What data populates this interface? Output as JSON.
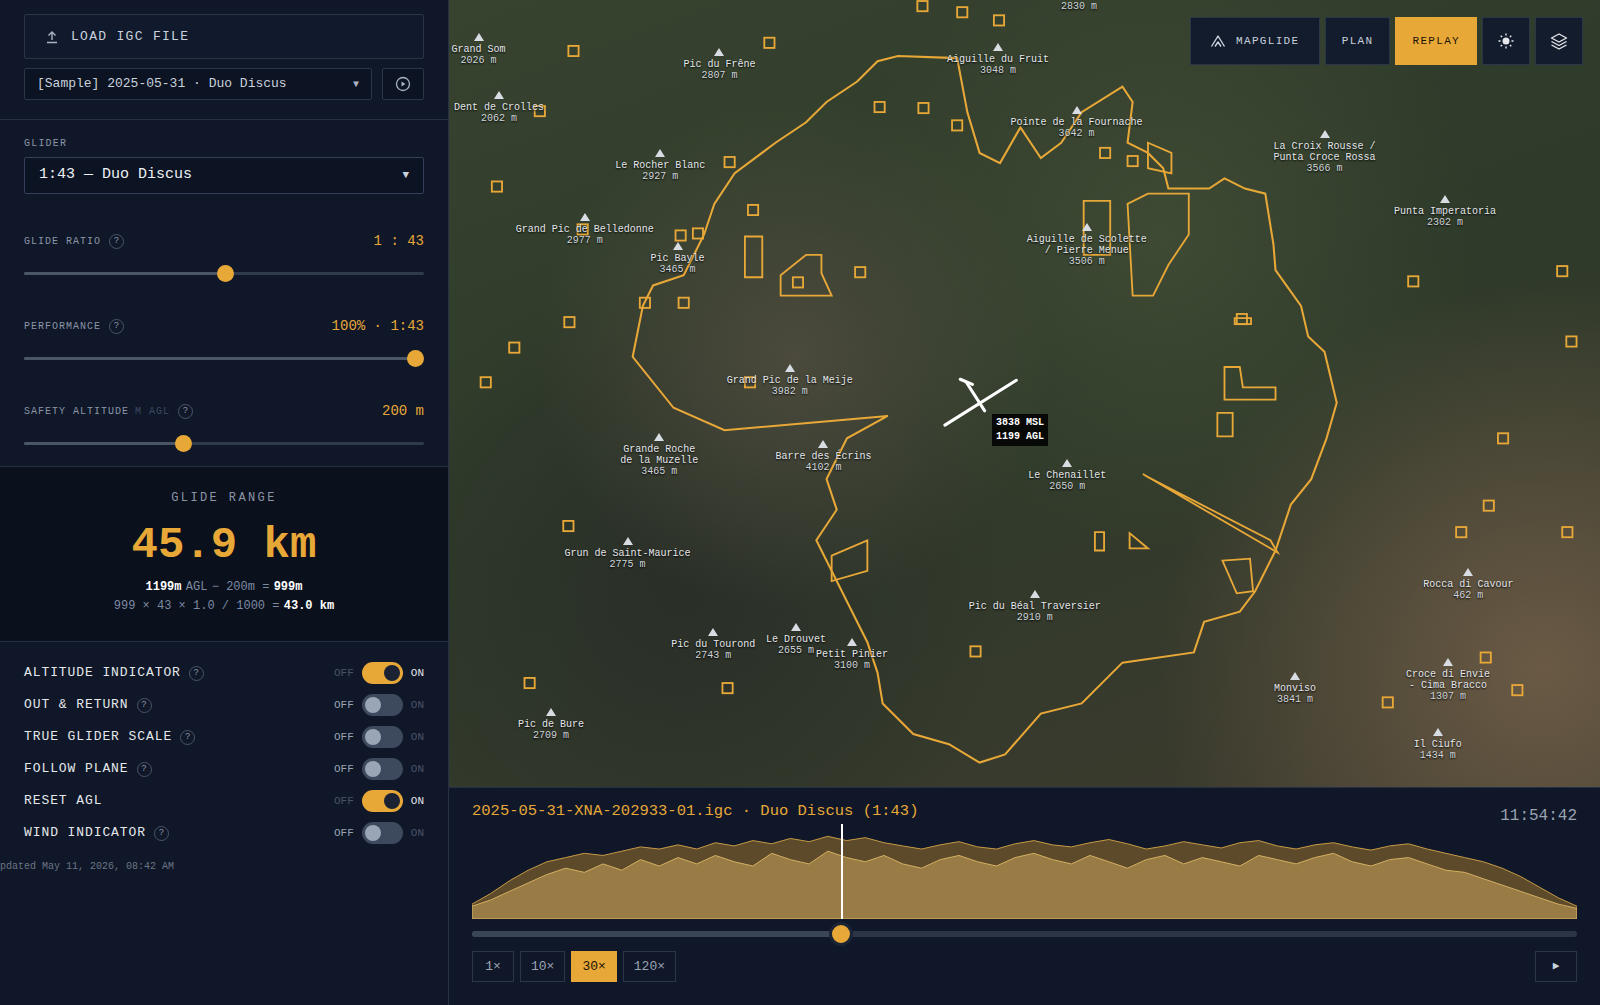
{
  "sidebar": {
    "load_button": {
      "label": "LOAD IGC FILE"
    },
    "file_select": {
      "value": "[Sample] 2025-05-31 · Duo Discus",
      "caret": "▼"
    },
    "glider": {
      "label": "GLIDER",
      "value": "1:43 — Duo Discus",
      "caret": "▼"
    },
    "sliders": [
      {
        "label": "GLIDE RATIO",
        "help": "?",
        "reading": "1 : 43",
        "level": 0.506
      },
      {
        "label": "PERFORMANCE",
        "help": "?",
        "reading": "100% · 1:43",
        "level": 0.98
      },
      {
        "label": "SAFETY ALTITUDE",
        "sublabel": "M AGL",
        "help": "?",
        "reading": "200 m",
        "level": 0.4
      }
    ],
    "glide_range": {
      "title": "GLIDE RANGE",
      "value": "45.9 km",
      "line1": [
        {
          "text": "1199m",
          "strong": true
        },
        {
          "text": "AGL",
          "strong": false
        },
        {
          "text": "− 200m =",
          "strong": false
        },
        {
          "text": "999m",
          "strong": true
        }
      ],
      "line2": [
        {
          "text": "999 × 43 × 1.0 / 1000 =",
          "strong": false
        },
        {
          "text": "43.0 km",
          "strong": true
        }
      ]
    },
    "toggles": [
      {
        "label": "ALTITUDE INDICATOR",
        "help": "?",
        "off_label": "OFF",
        "on_label": "ON",
        "on": true
      },
      {
        "label": "OUT & RETURN",
        "help": "?",
        "off_label": "OFF",
        "on_label": "ON",
        "on": false
      },
      {
        "label": "TRUE GLIDER SCALE",
        "help": "?",
        "off_label": "OFF",
        "on_label": "ON",
        "on": false
      },
      {
        "label": "FOLLOW PLANE",
        "help": "?",
        "off_label": "OFF",
        "on_label": "ON",
        "on": false
      },
      {
        "label": "RESET AGL",
        "off_label": "OFF",
        "on_label": "ON",
        "on": true
      },
      {
        "label": "WIND INDICATOR",
        "help": "?",
        "off_label": "OFF",
        "on_label": "ON",
        "on": false
      }
    ],
    "updated": "pdated May 11, 2026, 08:42 AM"
  },
  "toolbar": [
    {
      "kind": "logo",
      "label": "MAPGLIDE",
      "selected": false
    },
    {
      "kind": "text",
      "label": "PLAN",
      "selected": false
    },
    {
      "kind": "text",
      "label": "REPLAY",
      "selected": true
    },
    {
      "kind": "theme",
      "selected": false
    },
    {
      "kind": "layers",
      "selected": false
    }
  ],
  "map": {
    "cut_label": "2830 m",
    "peaks": [
      {
        "name": "Grand Som",
        "elevation": "2026 m"
      },
      {
        "name": "Dent de Crolles",
        "elevation": "2062 m"
      },
      {
        "name": "Pic du Frêne",
        "elevation": "2807 m"
      },
      {
        "name": "Aiguille du Fruit",
        "elevation": "3048 m"
      },
      {
        "name": "Pointe de la Fournache",
        "elevation": "3642 m"
      },
      {
        "name": "La Croix Rousse /\nPunta Croce Rossa",
        "elevation": "3566 m"
      },
      {
        "name": "Punta Imperatoria",
        "elevation": "2302 m"
      },
      {
        "name": "Le Rocher Blanc",
        "elevation": "2927 m"
      },
      {
        "name": "Grand Pic de Belledonne",
        "elevation": "2977 m"
      },
      {
        "name": "Pic Bayle",
        "elevation": "3465 m"
      },
      {
        "name": "Aiguille de Scolette\n/ Pierre Menue",
        "elevation": "3506 m"
      },
      {
        "name": "Grand Pic de la Meije",
        "elevation": "3982 m"
      },
      {
        "name": "Grande Roche\nde la Muzelle",
        "elevation": "3465 m"
      },
      {
        "name": "Barre des Écrins",
        "elevation": "4102 m"
      },
      {
        "name": "Le Chenaillet",
        "elevation": "2650 m"
      },
      {
        "name": "Grun de Saint-Maurice",
        "elevation": "2775 m"
      },
      {
        "name": "Pic du Béal Traversier",
        "elevation": "2910 m"
      },
      {
        "name": "Pic du Tourond",
        "elevation": "2743 m"
      },
      {
        "name": "Le Drouvet",
        "elevation": "2655 m"
      },
      {
        "name": "Petit Pinier",
        "elevation": "3100 m"
      },
      {
        "name": "Monviso",
        "elevation": "3841 m"
      },
      {
        "name": "Rocca di Cavour",
        "elevation": "462 m"
      },
      {
        "name": "Croce di Envie\n- Cima Bracco",
        "elevation": "1307 m"
      },
      {
        "name": "Il Ciufo",
        "elevation": "1434 m"
      },
      {
        "name": "Pic de Bure",
        "elevation": "2709 m"
      }
    ],
    "glider_tag": {
      "msl": "3838 MSL",
      "agl": "1199 AGL"
    }
  },
  "replay": {
    "title": "2025-05-31-XNA-202933-01.igc · Duo Discus (1:43)",
    "clock": "11:54:42",
    "chart": {
      "series": [
        {
          "name": "altitude",
          "values": [
            700,
            1200,
            1800,
            2300,
            2700,
            2900,
            3100,
            3000,
            3200,
            3400,
            3300,
            3500,
            3300,
            3600,
            3450,
            3700,
            3550,
            3800,
            3650,
            3900,
            3700,
            3838,
            3600,
            3450,
            3300,
            3500,
            3650,
            3400,
            3300,
            3550,
            3700,
            3500,
            3400,
            3600,
            3750,
            3550,
            3300,
            3450,
            3650,
            3500,
            3350,
            3600,
            3700,
            3450,
            3300,
            3500,
            3600,
            3400,
            3250,
            3450,
            3550,
            3300,
            3100,
            2900,
            2700,
            2400,
            2000,
            1500,
            1000,
            600
          ]
        },
        {
          "name": "terrain",
          "values": [
            600,
            900,
            1300,
            1700,
            2100,
            2400,
            2200,
            2600,
            2300,
            2800,
            2500,
            2900,
            2600,
            3000,
            2700,
            2500,
            3100,
            2800,
            2600,
            3200,
            2900,
            2700,
            3000,
            2600,
            2400,
            2800,
            3000,
            2700,
            2500,
            2900,
            3100,
            2800,
            2600,
            3000,
            2700,
            2400,
            2800,
            3000,
            2600,
            2900,
            2700,
            2500,
            3000,
            2800,
            2600,
            2900,
            3100,
            2700,
            2500,
            2800,
            2900,
            2600,
            2300,
            2200,
            1900,
            1600,
            1300,
            1000,
            700,
            500
          ]
        }
      ]
    },
    "position": 0.334,
    "speeds": [
      {
        "label": "1×",
        "selected": false
      },
      {
        "label": "10×",
        "selected": false
      },
      {
        "label": "30×",
        "selected": true
      },
      {
        "label": "120×",
        "selected": false
      }
    ],
    "play": "▶"
  }
}
